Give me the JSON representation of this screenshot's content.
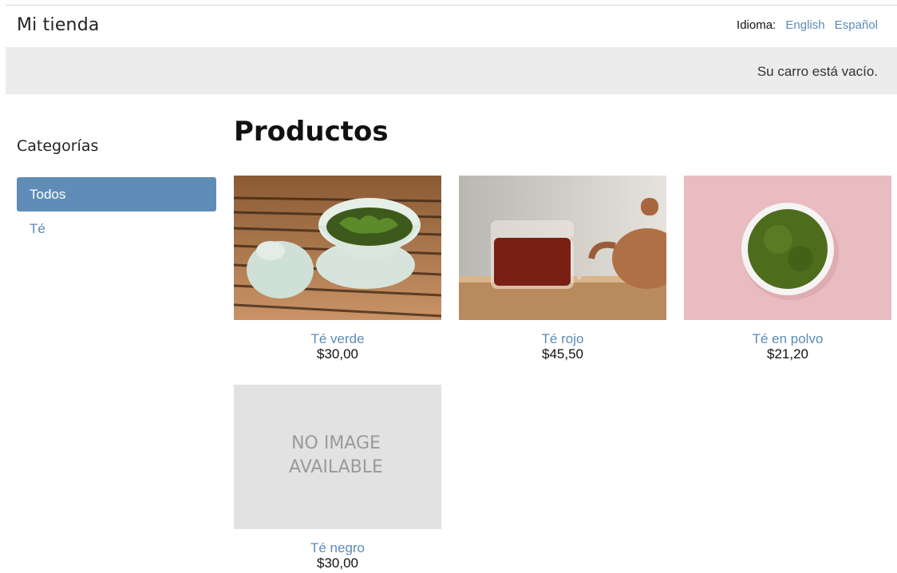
{
  "header": {
    "site_title": "Mi tienda",
    "language_label": "Idioma:",
    "languages": [
      "English",
      "Español"
    ]
  },
  "cart": {
    "status": "Su carro está vacío."
  },
  "sidebar": {
    "title": "Categorías",
    "items": [
      {
        "label": "Todos",
        "active": true
      },
      {
        "label": "Té",
        "active": false
      }
    ]
  },
  "main": {
    "title": "Productos",
    "products": [
      {
        "name": "Té verde",
        "price": "$30,00",
        "image": "green-tea-photo"
      },
      {
        "name": "Té rojo",
        "price": "$45,50",
        "image": "red-tea-photo"
      },
      {
        "name": "Té en polvo",
        "price": "$21,20",
        "image": "matcha-powder-photo"
      },
      {
        "name": "Té negro",
        "price": "$30,00",
        "image": "no-image-placeholder",
        "placeholder_text": [
          "NO IMAGE",
          "AVAILABLE"
        ]
      }
    ]
  },
  "colors": {
    "link": "#5b8bb8",
    "active_category": "#5f8db8",
    "cart_bar": "#ececec"
  }
}
